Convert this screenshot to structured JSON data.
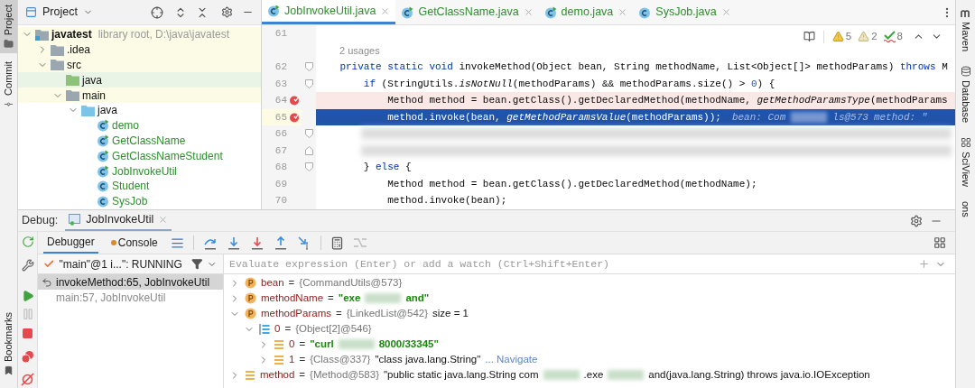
{
  "left_tool_tabs": [
    {
      "label": "Project",
      "kind": "project",
      "selected": true
    },
    {
      "label": "Commit",
      "kind": "commit",
      "selected": false
    }
  ],
  "bookmarks_tab": {
    "label": "Bookmarks"
  },
  "project": {
    "title": "Project",
    "tree": [
      {
        "label": "javatest",
        "kind": "module",
        "detail": "library root,  D:\\java\\javatest",
        "expanded": true,
        "color": "#fbfbe6",
        "children": [
          {
            "label": ".idea",
            "kind": "folder",
            "expanded": false,
            "color": "#fbfbe6"
          },
          {
            "label": "src",
            "kind": "folder",
            "expanded": true,
            "color": "#fbfbe6",
            "children": [
              {
                "label": "java",
                "kind": "source_root",
                "color": "#eaf4e6"
              },
              {
                "label": "main",
                "kind": "folder",
                "expanded": true,
                "color": "#fbfbe6",
                "children": [
                  {
                    "label": "java",
                    "kind": "package_root",
                    "expanded": true,
                    "children": [
                      {
                        "label": "demo",
                        "kind": "runnable_class"
                      },
                      {
                        "label": "GetClassName",
                        "kind": "runnable_class"
                      },
                      {
                        "label": "GetClassNameStudent",
                        "kind": "runnable_class"
                      },
                      {
                        "label": "JobInvokeUtil",
                        "kind": "runnable_class"
                      },
                      {
                        "label": "Student",
                        "kind": "class"
                      },
                      {
                        "label": "SysJob",
                        "kind": "class"
                      }
                    ]
                  }
                ]
              }
            ]
          }
        ]
      }
    ]
  },
  "editor": {
    "tabs": [
      {
        "label": "JobInvokeUtil.java",
        "kind": "runnable_class",
        "selected": true
      },
      {
        "label": "GetClassName.java",
        "kind": "runnable_class",
        "selected": false
      },
      {
        "label": "demo.java",
        "kind": "runnable_class",
        "selected": false
      },
      {
        "label": "SysJob.java",
        "kind": "class",
        "selected": false
      }
    ],
    "inspections": [
      {
        "kind": "warning",
        "count": "5"
      },
      {
        "kind": "weak_warning",
        "count": "2"
      },
      {
        "kind": "typo",
        "count": "8"
      }
    ],
    "lines": [
      {
        "kind": "code",
        "number": "61",
        "breakpoint": false,
        "current": false
      },
      {
        "kind": "usages",
        "text": "2 usages"
      },
      {
        "kind": "code",
        "number": "62",
        "breakpoint": false,
        "current": false,
        "fold": {
          "kind": "start"
        },
        "code": [
          {
            "kind": "keyword",
            "text": "    private static void"
          },
          {
            "kind": "plain",
            "text": " invokeMethod(Object bean, String methodName, List<Object[]> methodParams) "
          },
          {
            "kind": "keyword",
            "text": "throws"
          },
          {
            "kind": "plain",
            "text": " M"
          }
        ]
      },
      {
        "kind": "code",
        "number": "63",
        "breakpoint": false,
        "current": false,
        "fold": {
          "kind": "start"
        },
        "code": [
          {
            "kind": "keyword",
            "text": "        if"
          },
          {
            "kind": "plain",
            "text": " (StringUtils."
          },
          {
            "kind": "call",
            "text": "isNotNull"
          },
          {
            "kind": "plain",
            "text": "(methodParams) && methodParams.size() > "
          },
          {
            "kind": "number",
            "text": "0"
          },
          {
            "kind": "plain",
            "text": ") {"
          }
        ]
      },
      {
        "kind": "code",
        "number": "64",
        "breakpoint": true,
        "current": false,
        "code": [
          {
            "kind": "plain",
            "text": "            Method method = bean.getClass().getDeclaredMethod(methodName, "
          },
          {
            "kind": "call",
            "text": "getMethodParamsType"
          },
          {
            "kind": "plain",
            "text": "(methodParams"
          }
        ]
      },
      {
        "kind": "code",
        "number": "65",
        "breakpoint": true,
        "current": true,
        "code": [
          {
            "kind": "plain",
            "text": "            method.invoke(bean, "
          },
          {
            "kind": "call",
            "text": "getMethodParamsValue"
          },
          {
            "kind": "plain",
            "text": "(methodParams));"
          }
        ],
        "hints": [
          {
            "kind": "text",
            "text": "bean: Com"
          },
          {
            "kind": "blur"
          },
          {
            "kind": "text",
            "text": "ls@573"
          },
          {
            "kind": "text",
            "text": "method: \""
          }
        ]
      },
      {
        "kind": "blurred",
        "number": "66",
        "breakpoint": false,
        "current": false,
        "fold": {
          "kind": "start"
        }
      },
      {
        "kind": "blurred",
        "number": "67",
        "breakpoint": false,
        "current": false,
        "fold": {
          "kind": "end"
        }
      },
      {
        "kind": "code",
        "number": "68",
        "breakpoint": false,
        "current": false,
        "fold": {
          "kind": "start"
        },
        "code": [
          {
            "kind": "plain",
            "text": "        } "
          },
          {
            "kind": "keyword",
            "text": "else"
          },
          {
            "kind": "plain",
            "text": " {"
          }
        ]
      },
      {
        "kind": "code",
        "number": "69",
        "breakpoint": false,
        "current": false,
        "code": [
          {
            "kind": "plain",
            "text": "            Method method = bean.getClass().getDeclaredMethod(methodName);"
          }
        ]
      },
      {
        "kind": "code",
        "number": "70",
        "breakpoint": false,
        "current": false,
        "code": [
          {
            "kind": "plain",
            "text": "            method.invoke(bean);"
          }
        ]
      }
    ]
  },
  "right_tool_tabs": [
    {
      "label": "Maven",
      "kind": "maven"
    },
    {
      "label": "Database",
      "kind": "database"
    },
    {
      "label": "SciView",
      "kind": "sciview"
    },
    {
      "label": "ons",
      "kind": "plain"
    }
  ],
  "debug": {
    "title": "Debug:",
    "session": "JobInvokeUtil",
    "tabs": [
      {
        "label": "Debugger",
        "kind": "debugger",
        "selected": true
      },
      {
        "label": "Console",
        "kind": "console",
        "selected": false
      }
    ],
    "thread": "\"main\"@1 i...\": RUNNING",
    "frames": [
      {
        "label": "invokeMethod:65, JobInvokeUtil",
        "selected": true
      },
      {
        "label": "main:57, JobInvokeUtil",
        "selected": false
      }
    ],
    "watch": {
      "placeholder": "Evaluate expression (Enter) or add a watch (Ctrl+Shift+Enter)"
    },
    "variables": [
      {
        "name": "bean",
        "kind": "param",
        "expanded": false,
        "value": [
          {
            "kind": "operator",
            "text": "="
          },
          {
            "kind": "ref",
            "text": "{CommandUtils@573}"
          }
        ]
      },
      {
        "name": "methodName",
        "kind": "param",
        "expanded": false,
        "value": [
          {
            "kind": "operator",
            "text": "="
          },
          {
            "kind": "string",
            "text": "\"exe"
          },
          {
            "kind": "blur"
          },
          {
            "kind": "string",
            "text": "and\""
          }
        ]
      },
      {
        "name": "methodParams",
        "kind": "param",
        "expanded": true,
        "value": [
          {
            "kind": "operator",
            "text": "="
          },
          {
            "kind": "ref",
            "text": "{LinkedList@542}"
          },
          {
            "kind": "plain",
            "text": "size = 1"
          }
        ],
        "children": [
          {
            "name": "0",
            "kind": "array",
            "expanded": true,
            "value": [
              {
                "kind": "operator",
                "text": "="
              },
              {
                "kind": "ref",
                "text": "{Object[2]@546}"
              }
            ],
            "children": [
              {
                "name": "0",
                "kind": "element",
                "expanded": false,
                "value": [
                  {
                    "kind": "operator",
                    "text": "="
                  },
                  {
                    "kind": "string",
                    "text": "\"curl"
                  },
                  {
                    "kind": "blur"
                  },
                  {
                    "kind": "string",
                    "text": "8000/33345\""
                  }
                ]
              },
              {
                "name": "1",
                "kind": "element",
                "expanded": false,
                "value": [
                  {
                    "kind": "operator",
                    "text": "="
                  },
                  {
                    "kind": "ref",
                    "text": "{Class@337}"
                  },
                  {
                    "kind": "plain",
                    "text": "\"class java.lang.String\""
                  },
                  {
                    "kind": "link",
                    "text": "... Navigate"
                  }
                ]
              }
            ]
          }
        ]
      },
      {
        "name": "method",
        "kind": "field",
        "expanded": false,
        "value": [
          {
            "kind": "operator",
            "text": "="
          },
          {
            "kind": "ref",
            "text": "{Method@583}"
          },
          {
            "kind": "plain",
            "text": "\"public static java.lang.String com"
          },
          {
            "kind": "blur"
          },
          {
            "kind": "plain",
            "text": ".exe"
          },
          {
            "kind": "blur"
          },
          {
            "kind": "plain",
            "text": "and(java.lang.String) throws java.io.IOException"
          }
        ]
      }
    ]
  }
}
